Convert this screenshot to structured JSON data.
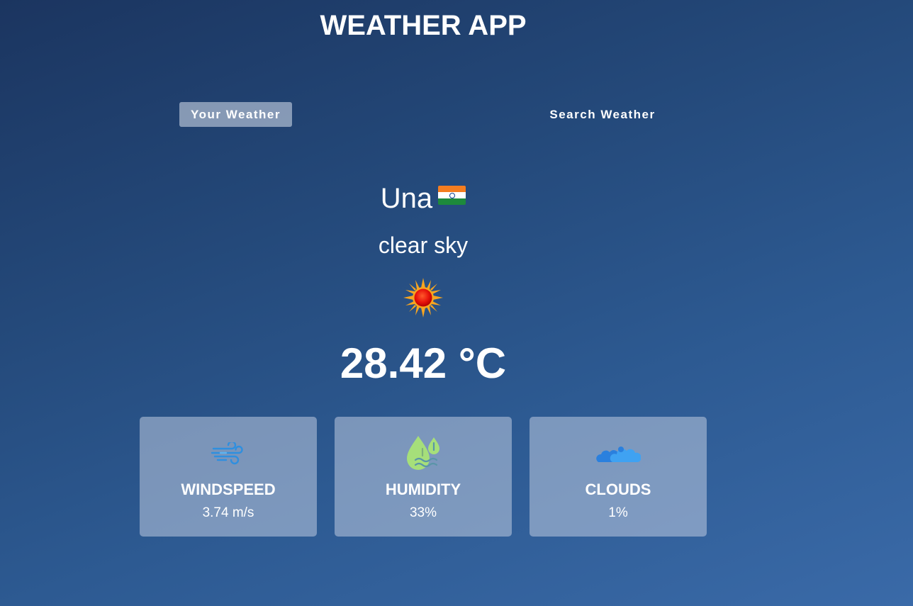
{
  "app": {
    "title": "WEATHER APP"
  },
  "tabs": [
    {
      "label": "Your Weather",
      "active": true
    },
    {
      "label": "Search Weather",
      "active": false
    }
  ],
  "weather": {
    "city": "Una",
    "country_flag_icon": "india-flag-icon",
    "description": "clear sky",
    "condition_icon": "sun-icon",
    "temperature": "28.42 °C"
  },
  "stats": [
    {
      "label": "WINDSPEED",
      "value": "3.74 m/s",
      "icon": "wind-icon"
    },
    {
      "label": "HUMIDITY",
      "value": "33%",
      "icon": "humidity-icon"
    },
    {
      "label": "CLOUDS",
      "value": "1%",
      "icon": "clouds-icon"
    }
  ],
  "colors": {
    "background_top": "#1b3560",
    "background_bottom": "#3a6aa8",
    "card_bg": "#8aa0c0",
    "text": "#ffffff"
  }
}
